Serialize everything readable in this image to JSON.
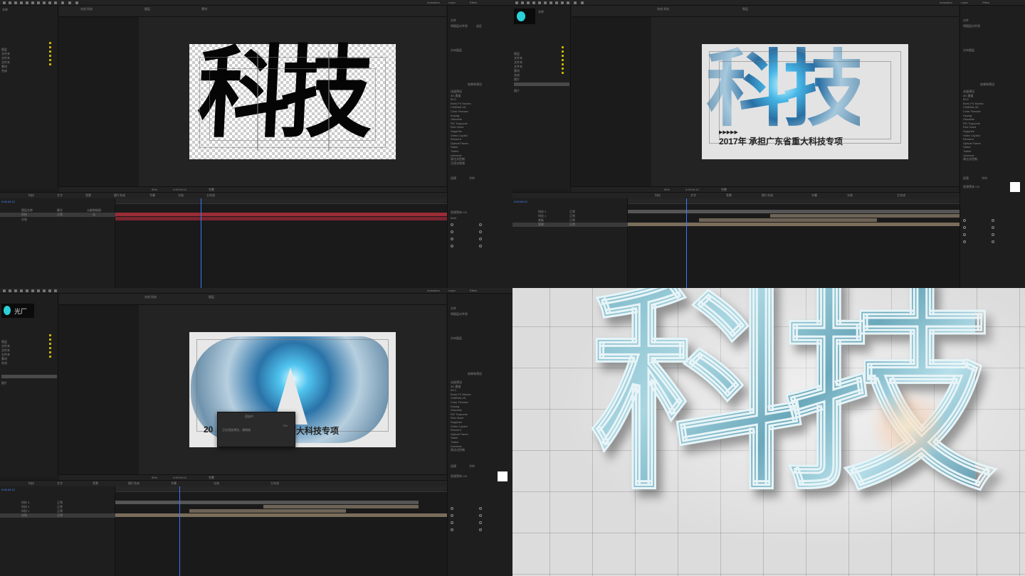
{
  "app": {
    "menu": [
      "Animation",
      "Layer",
      "Effect"
    ],
    "project_items": [
      "图层",
      "文件夹",
      "文件夹",
      "文件夹",
      "素材",
      "合成",
      "图片"
    ],
    "project_header": "名称",
    "right_panel": {
      "sections": [
        "对齐",
        "段落",
        "字符",
        "效果和预设"
      ],
      "align_label": "将图层对齐到",
      "align_value": "选区",
      "distribute_label": "分布图层",
      "effects_search": "效果和预设",
      "effects": [
        "动画预设",
        "3D 通道",
        "BCC",
        "Boris FX Mocha",
        "CINEMA 4D",
        "Color Finesse",
        "Keying",
        "Obsolete",
        "RG Trapcode",
        "Red Giant",
        "Sapphire",
        "Video Copilot",
        "Element",
        "Optical Flares",
        "Saber",
        "Twitch",
        "Universe",
        "表达式控制",
        "沉浸式视频",
        "风格化",
        "过渡",
        "过时",
        "抠像",
        "模糊和锐化",
        "模拟",
        "扭曲",
        "生成",
        "时间",
        "实用工具"
      ],
      "paragraph_tab": "段落",
      "character_tab": "字符",
      "font_name": "思源黑体 CN",
      "font_style": "Bold"
    },
    "comp_tabs": [
      "合成 科技",
      "图层",
      "素材"
    ],
    "viewer_zoom": "50%",
    "viewer_res": "完整",
    "timecode": "0:00:04:12",
    "layers_header": [
      "图层名称",
      "模式",
      "T",
      "父级和链接"
    ],
    "layers_q1": [
      "科技",
      "光效"
    ],
    "layers_q2": [
      "科技 2",
      "科技 1",
      "底板",
      "背景"
    ],
    "layers_q3": [
      "科技 3",
      "科技 2",
      "科技 1",
      "光效"
    ],
    "mode_normal": "正常",
    "parent_none": "无",
    "timeline_tabs": [
      "科技",
      "文字",
      "背景",
      "图片合成",
      "字幕",
      "光效",
      "主合成"
    ],
    "dialog_title": "渲染中",
    "dialog_text": "正在渲染预览，请稍候",
    "dialog_value": "0%"
  },
  "canvas": {
    "title_chars": "科技",
    "subtitle": "2017年 承担广东省重大科技专项",
    "subtitle_right": "大科技专项",
    "subtitle_left": "20",
    "arrows": "▶▶▶▶▶",
    "logo_text": "光厂"
  },
  "colors": {
    "panel_bg": "#1c1c1c",
    "accent_blue": "#3b78ff",
    "track_red": "#9a2c36",
    "track_tan": "#7a6d5a",
    "label_yellow": "#c8b000"
  }
}
